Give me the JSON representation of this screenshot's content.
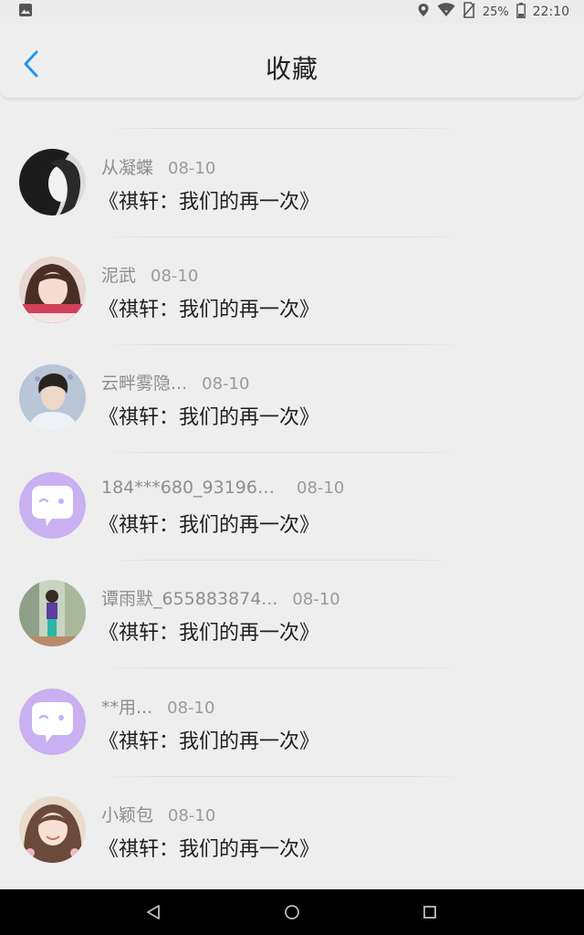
{
  "status_bar": {
    "battery": "25%",
    "time": "22:10"
  },
  "header": {
    "title": "收藏"
  },
  "items": [
    {
      "name": "",
      "date": "",
      "title": ""
    },
    {
      "name": "从凝蝶",
      "date": "08-10",
      "title": "《祺轩：我们的再一次》",
      "avatar": "photo-dark-hair"
    },
    {
      "name": "泥武",
      "date": "08-10",
      "title": "《祺轩：我们的再一次》",
      "avatar": "photo-girl"
    },
    {
      "name": "云畔雾隐...",
      "date": "08-10",
      "title": "《祺轩：我们的再一次》",
      "avatar": "photo-boy"
    },
    {
      "name": "184***680_931963...",
      "date": "08-10",
      "title": "《祺轩：我们的再一次》",
      "avatar": "default-chat-avatar"
    },
    {
      "name": "谭雨默_655883874...",
      "date": "08-10",
      "title": "《祺轩：我们的再一次》",
      "avatar": "photo-outdoor"
    },
    {
      "name": "**用...",
      "date": "08-10",
      "title": "《祺轩：我们的再一次》",
      "avatar": "default-chat-avatar"
    },
    {
      "name": "小颖包",
      "date": "08-10",
      "title": "《祺轩：我们的再一次》",
      "avatar": "photo-smiling-girl"
    }
  ],
  "colors": {
    "accent": "#2196f3",
    "default_avatar": "#c9b0f0",
    "background": "#eeeeee"
  }
}
